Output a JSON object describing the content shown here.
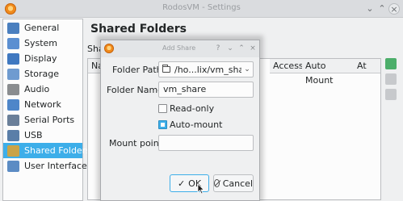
{
  "window": {
    "title": "RodosVM - Settings"
  },
  "sidebar": {
    "items": [
      {
        "label": "General",
        "icon": "general-icon",
        "color": "#4a7fbf"
      },
      {
        "label": "System",
        "icon": "system-icon",
        "color": "#5b8fd1"
      },
      {
        "label": "Display",
        "icon": "display-icon",
        "color": "#3f78c0"
      },
      {
        "label": "Storage",
        "icon": "storage-icon",
        "color": "#6f9bd0"
      },
      {
        "label": "Audio",
        "icon": "audio-icon",
        "color": "#8a8d90"
      },
      {
        "label": "Network",
        "icon": "network-icon",
        "color": "#4e86c9"
      },
      {
        "label": "Serial Ports",
        "icon": "serial-ports-icon",
        "color": "#6a7f99"
      },
      {
        "label": "USB",
        "icon": "usb-icon",
        "color": "#5a7ea8"
      },
      {
        "label": "Shared Folders",
        "icon": "shared-folders-icon",
        "color": "#c9a347",
        "selected": true
      },
      {
        "label": "User Interface",
        "icon": "user-interface-icon",
        "color": "#5c8cc4"
      }
    ]
  },
  "main": {
    "title": "Shared Folders",
    "section_label": "Shar",
    "table": {
      "headers": [
        "Na",
        "Access",
        "Auto Mount",
        "At"
      ]
    }
  },
  "dialog": {
    "title": "Add Share",
    "folder_path_label": "Folder Path:",
    "folder_path_value": "/ho...lix/vm_share",
    "folder_name_label": "Folder Name:",
    "folder_name_value": "vm_share",
    "read_only_label": "Read-only",
    "read_only_checked": false,
    "auto_mount_label": "Auto-mount",
    "auto_mount_checked": true,
    "mount_point_label": "Mount point:",
    "mount_point_value": "",
    "ok_label": "OK",
    "cancel_label": "Cancel"
  },
  "colors": {
    "accent": "#3daee9",
    "window_bg": "#eff0f1"
  }
}
